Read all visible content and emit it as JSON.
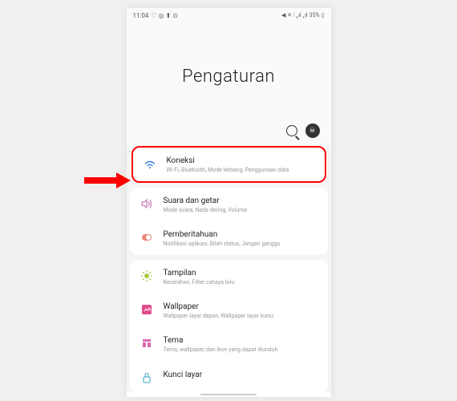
{
  "status": {
    "time": "11:04",
    "left_icons": "♡ ◎ ⬆ ⊙",
    "right_icons": "◀ ✕ ⁞ ₊ıl ₊ıl",
    "battery": "35%",
    "battery_icon": "▯"
  },
  "header": {
    "title": "Pengaturan"
  },
  "toolbar": {
    "avatar_glyph": "☠"
  },
  "groups": [
    {
      "items": [
        {
          "title": "Koneksi",
          "subtitle": "Wi-Fi, Bluetooth, Mode terbang, Penggunaan data",
          "icon": "wifi",
          "highlighted": true
        }
      ]
    },
    {
      "items": [
        {
          "title": "Suara dan getar",
          "subtitle": "Mode suara, Nada dering, Volume",
          "icon": "sound"
        },
        {
          "title": "Pemberitahuan",
          "subtitle": "Notifikasi aplikasi, Bilah status, Jangan ganggu",
          "icon": "notification"
        }
      ]
    },
    {
      "items": [
        {
          "title": "Tampilan",
          "subtitle": "Kecerahan, Filter cahaya biru",
          "icon": "display"
        },
        {
          "title": "Wallpaper",
          "subtitle": "Wallpaper layar depan, Wallpaper layar kunci",
          "icon": "wallpaper"
        },
        {
          "title": "Tema",
          "subtitle": "Tema, wallpaper, dan ikon yang dapat diunduh",
          "icon": "theme"
        },
        {
          "title": "Kunci layar",
          "subtitle": "",
          "icon": "lock"
        }
      ]
    }
  ],
  "watermark": ""
}
